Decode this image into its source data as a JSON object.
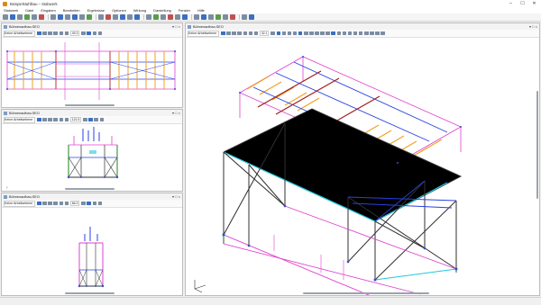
{
  "window": {
    "title": "Beispielstahlbau – Stabwerk",
    "minimize": "–",
    "maximize": "☐",
    "close": "✕"
  },
  "menu": [
    "Stabwerk",
    "Datei",
    "Eingaben",
    "Bearbeiten",
    "Ergebnisse",
    "Optionen",
    "Wirkung",
    "Darstellung",
    "Fenster",
    "Hilfe"
  ],
  "colors": {
    "accent": "#3b6fc1",
    "magenta": "#e040d0",
    "orange": "#f0a020",
    "cyan": "#22c8e0",
    "blue": "#2a40e0",
    "red": "#c03030",
    "green": "#208020",
    "dark": "#303030"
  },
  "panes": {
    "top": {
      "title": "Bühnenaufbau.SEO",
      "selector": "Keine Arbeitsebene",
      "zoom": "49.3"
    },
    "mid": {
      "title": "Bühnenaufbau.SEO",
      "selector": "Keine Arbeitsebene",
      "zoom": "121.5"
    },
    "bottom": {
      "title": "Bühnenaufbau.SEO",
      "selector": "Keine Arbeitsebene",
      "zoom": "66.3"
    },
    "main": {
      "title": "Bühnenaufbau.SEO",
      "selector": "Keine Arbeitsebene",
      "zoom": "32.1"
    }
  },
  "pane_controls": {
    "pin": "▾",
    "max": "□",
    "close": "×"
  },
  "icons": [
    "app-icon",
    "file-icon",
    "save-icon",
    "print-icon",
    "undo-icon",
    "redo-icon",
    "zoom-icon",
    "rotate-icon",
    "select-icon",
    "view-icon",
    "axis-icon"
  ]
}
